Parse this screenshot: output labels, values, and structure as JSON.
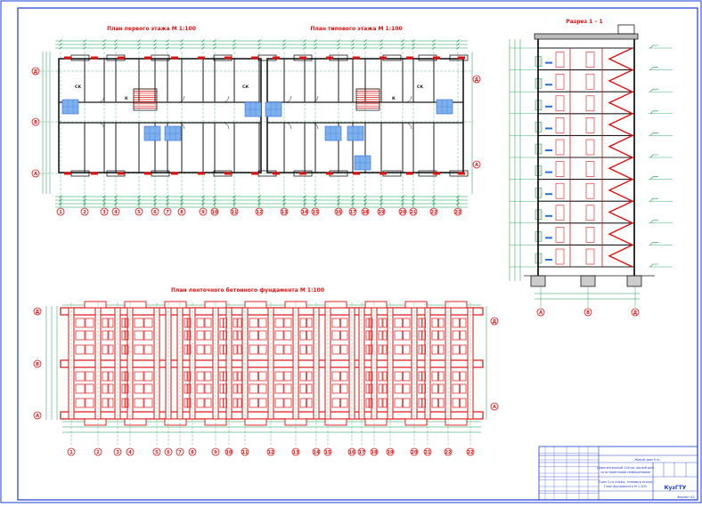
{
  "drawing": {
    "plan1_title": "План первого этажа  М 1:100",
    "plan2_title": "План типового этажа  М 1:100",
    "section_title": "Разрез 1 – 1",
    "foundation_title": "План ленточного бетонного фундамента  М 1:100"
  },
  "room_labels": [
    "СК",
    "К",
    "СК",
    "К",
    "СК"
  ],
  "axis_labels": {
    "rows": [
      "Д",
      "В",
      "А"
    ],
    "section_axes": [
      "А",
      "В",
      "Д"
    ],
    "columns": [
      "1",
      "2",
      "3",
      "4",
      "5",
      "6",
      "7",
      "8",
      "9",
      "10",
      "11",
      "12",
      "13",
      "14",
      "15",
      "16",
      "17",
      "18",
      "19",
      "20",
      "21",
      "22"
    ]
  },
  "title_block": {
    "header": "Жилой дом 9 эт.",
    "line1": "Девятиэтажный 126-кв. жилой дом",
    "line2": "со встроенными помещениями",
    "line3": "План 1-го этажа, типового этажа",
    "line4": "План фундамента М 1:100",
    "org": "КузГТУ",
    "format": "Формат А2"
  },
  "colors": {
    "wall": "#e01010",
    "dims": "#0a9a4a",
    "blue": "#2b6ed8",
    "ink": "#1a3bd6",
    "fill": "#1a1a1a"
  }
}
